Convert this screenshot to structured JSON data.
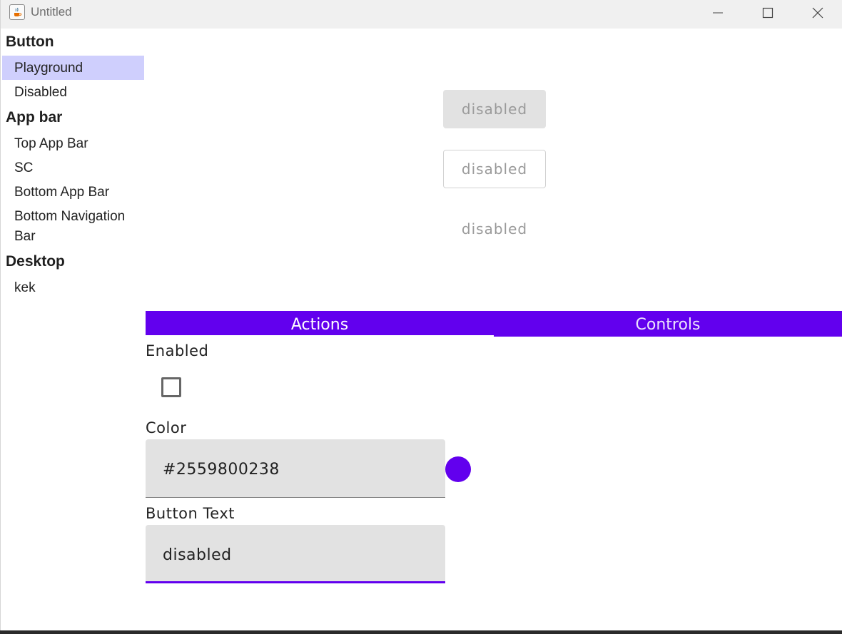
{
  "window": {
    "title": "Untitled"
  },
  "colors": {
    "accent": "#6200ee",
    "selected": "#cfcffd",
    "disabled_bg": "#e2e2e2",
    "disabled_text": "#9a9a9a"
  },
  "icons": {
    "app": "java-app-icon",
    "minimize": "minimize-icon",
    "maximize": "maximize-icon",
    "close": "close-icon"
  },
  "sidebar": {
    "sections": [
      {
        "title": "Button",
        "items": [
          "Playground",
          "Disabled"
        ]
      },
      {
        "title": "App bar",
        "items": [
          "Top App Bar",
          "SC",
          "Bottom App Bar",
          "Bottom Navigation Bar"
        ]
      },
      {
        "title": "Desktop",
        "items": [
          "kek"
        ]
      }
    ],
    "selected": "Playground"
  },
  "preview": {
    "contained_label": "disabled",
    "outlined_label": "disabled",
    "text_label": "disabled"
  },
  "tabs": [
    {
      "label": "Actions"
    },
    {
      "label": "Controls"
    }
  ],
  "controls": {
    "enabled_label": "Enabled",
    "enabled_checked": false,
    "color_label": "Color",
    "color_value": "#2559800238",
    "button_text_label": "Button Text",
    "button_text_value": "disabled"
  }
}
